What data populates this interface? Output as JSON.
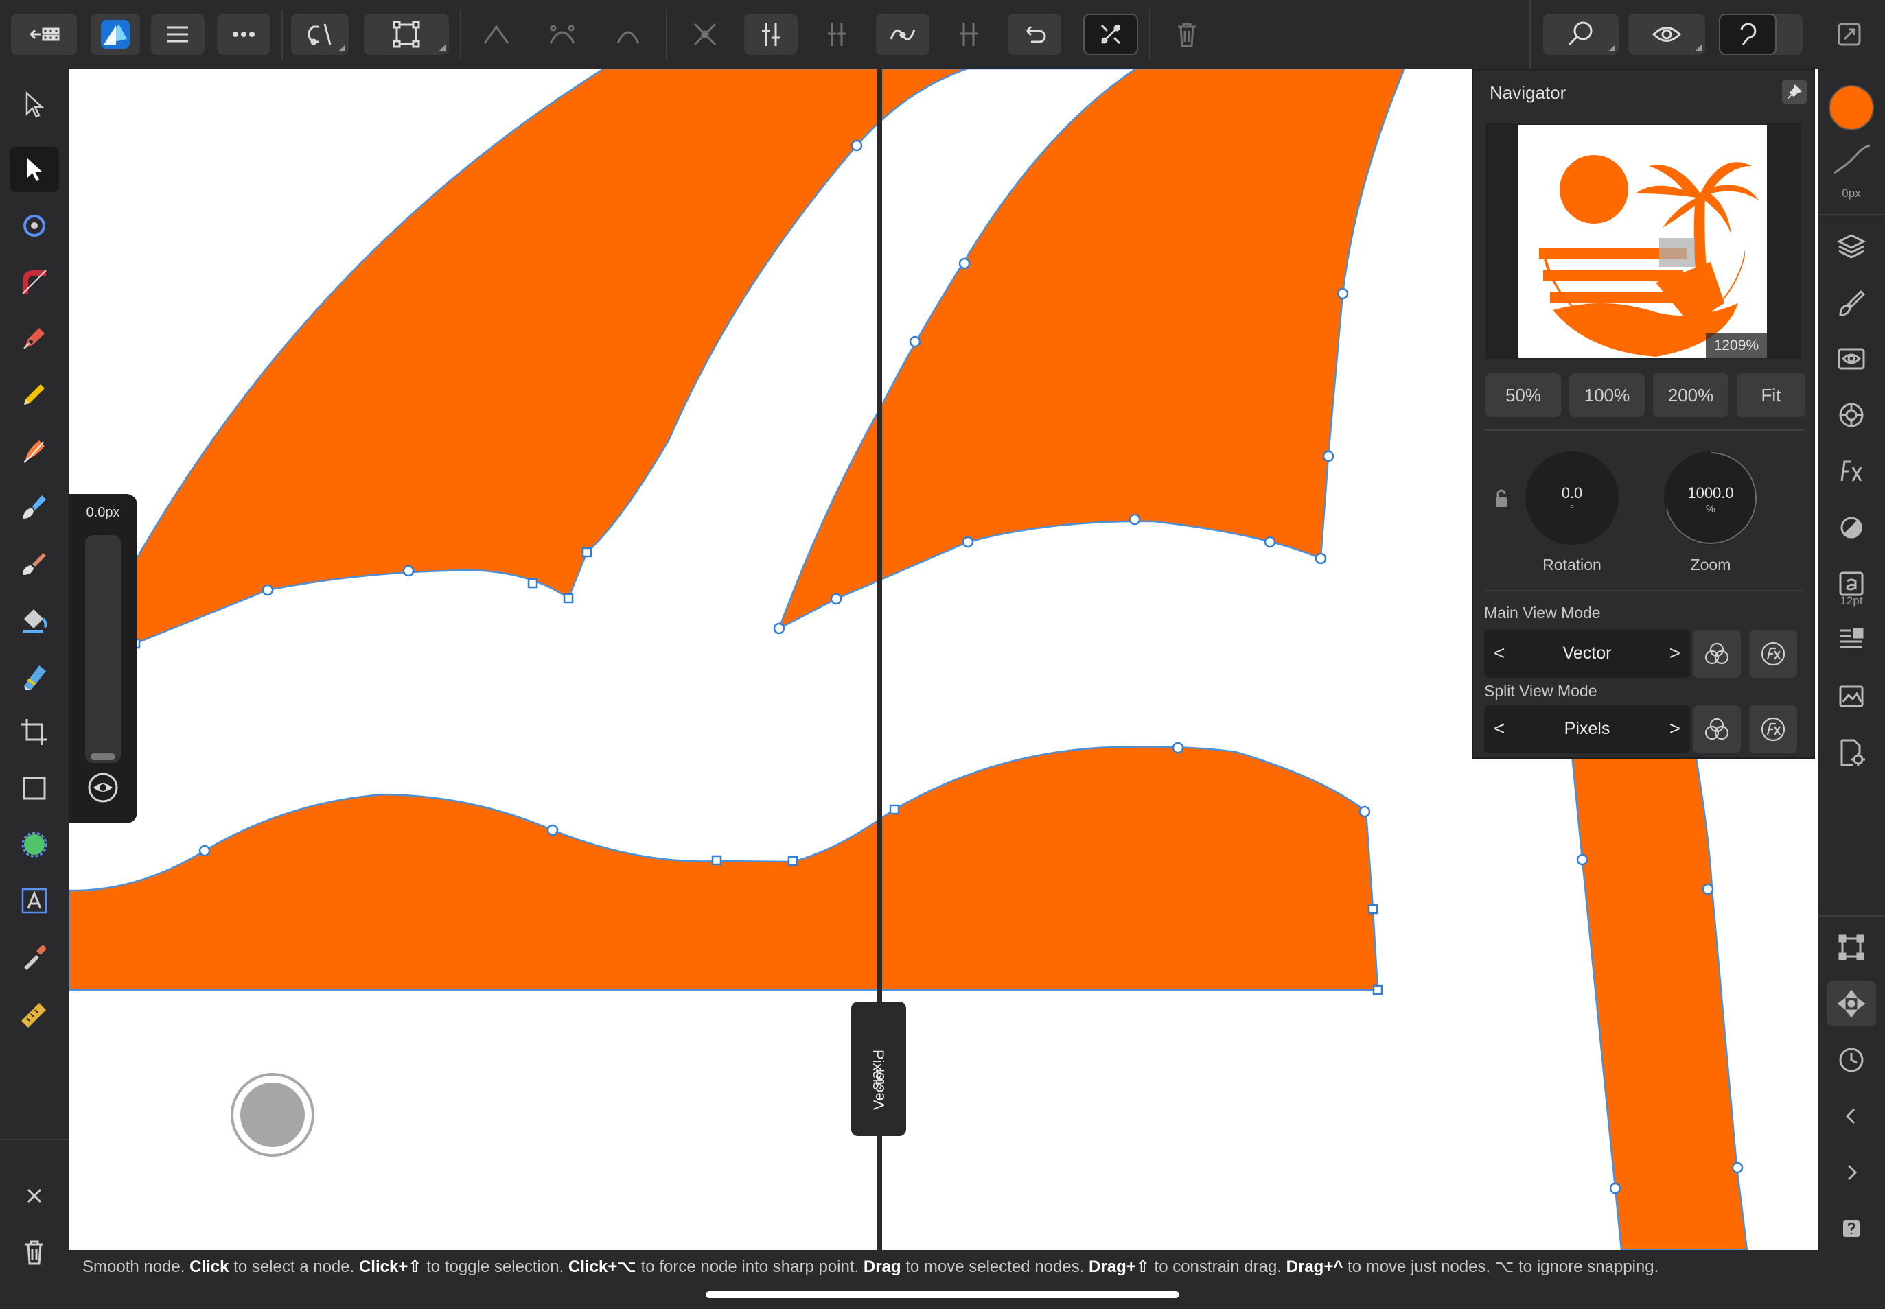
{
  "status_bar": {
    "parts": [
      {
        "text": "Smooth node. ",
        "bold": false
      },
      {
        "text": "Click",
        "bold": true
      },
      {
        "text": " to select a node. ",
        "bold": false
      },
      {
        "text": "Click+⇧",
        "bold": true
      },
      {
        "text": " to toggle selection. ",
        "bold": false
      },
      {
        "text": "Click+⌥",
        "bold": true
      },
      {
        "text": " to force node into sharp point. ",
        "bold": false
      },
      {
        "text": "Drag",
        "bold": true
      },
      {
        "text": " to move selected nodes. ",
        "bold": false
      },
      {
        "text": "Drag+⇧",
        "bold": true
      },
      {
        "text": " to constrain drag. ",
        "bold": false
      },
      {
        "text": "Drag+^",
        "bold": true
      },
      {
        "text": " to move just nodes. ⌥ to ignore snapping.",
        "bold": false
      }
    ]
  },
  "size_slider": {
    "value": "0.0px"
  },
  "split_view": {
    "left_label": "Vector",
    "right_label": "Pixels"
  },
  "navigator": {
    "title": "Navigator",
    "zoom_display": "1209%",
    "zoom_buttons": [
      "50%",
      "100%",
      "200%",
      "Fit"
    ],
    "rotation": {
      "value": "0.0",
      "unit": "°",
      "label": "Rotation"
    },
    "zoom": {
      "value": "1000.0",
      "unit": "%",
      "label": "Zoom"
    },
    "main_view_mode": {
      "title": "Main View Mode",
      "value": "Vector"
    },
    "split_view_mode": {
      "title": "Split View Mode",
      "value": "Pixels"
    }
  },
  "right_panel": {
    "stroke_width": "0px",
    "font_size": "12pt"
  },
  "colors": {
    "fill": "#ff6a00",
    "curve": "#4a90d9",
    "app_accent": "#1e88e5"
  },
  "icons": {
    "top": [
      "back-to-gallery-icon",
      "affinity-designer-logo-icon",
      "hamburger-menu-icon",
      "more-icon",
      "snapping-magnet-icon",
      "transform-mode-icon",
      "sharp-node-icon",
      "smooth-node-icon",
      "smart-node-icon",
      "break-curve-icon",
      "close-curve-icon",
      "smooth-curve-icon",
      "join-curves-icon",
      "reverse-curve-icon",
      "convert-to-curve-icon",
      "delete-node-icon",
      "view-tool-icon",
      "view-mode-icon",
      "undo-icon",
      "fullscreen-icon"
    ]
  }
}
